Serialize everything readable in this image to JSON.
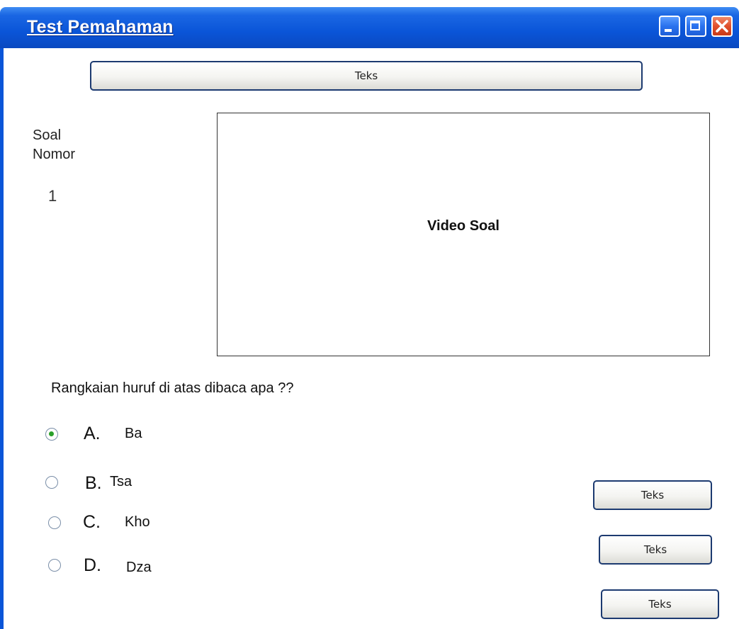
{
  "window": {
    "title": "Test Pemahaman"
  },
  "top_button": {
    "label": "Teks"
  },
  "soal": {
    "label_line1": "Soal",
    "label_line2": "Nomor",
    "number": "1"
  },
  "video": {
    "label": "Video Soal"
  },
  "question": {
    "text": "Rangkaian huruf di atas dibaca apa ??"
  },
  "options": [
    {
      "letter": "A.",
      "text": "Ba",
      "selected": true
    },
    {
      "letter": "B.",
      "text": "Tsa",
      "selected": false
    },
    {
      "letter": "C.",
      "text": "Kho",
      "selected": false
    },
    {
      "letter": "D.",
      "text": "Dza",
      "selected": false
    }
  ],
  "side_buttons": [
    {
      "label": "Teks"
    },
    {
      "label": "Teks"
    },
    {
      "label": "Teks"
    }
  ],
  "colors": {
    "titlebar": "#0a55d8",
    "close_button": "#e0502c",
    "radio_selected": "#2aa02a"
  }
}
